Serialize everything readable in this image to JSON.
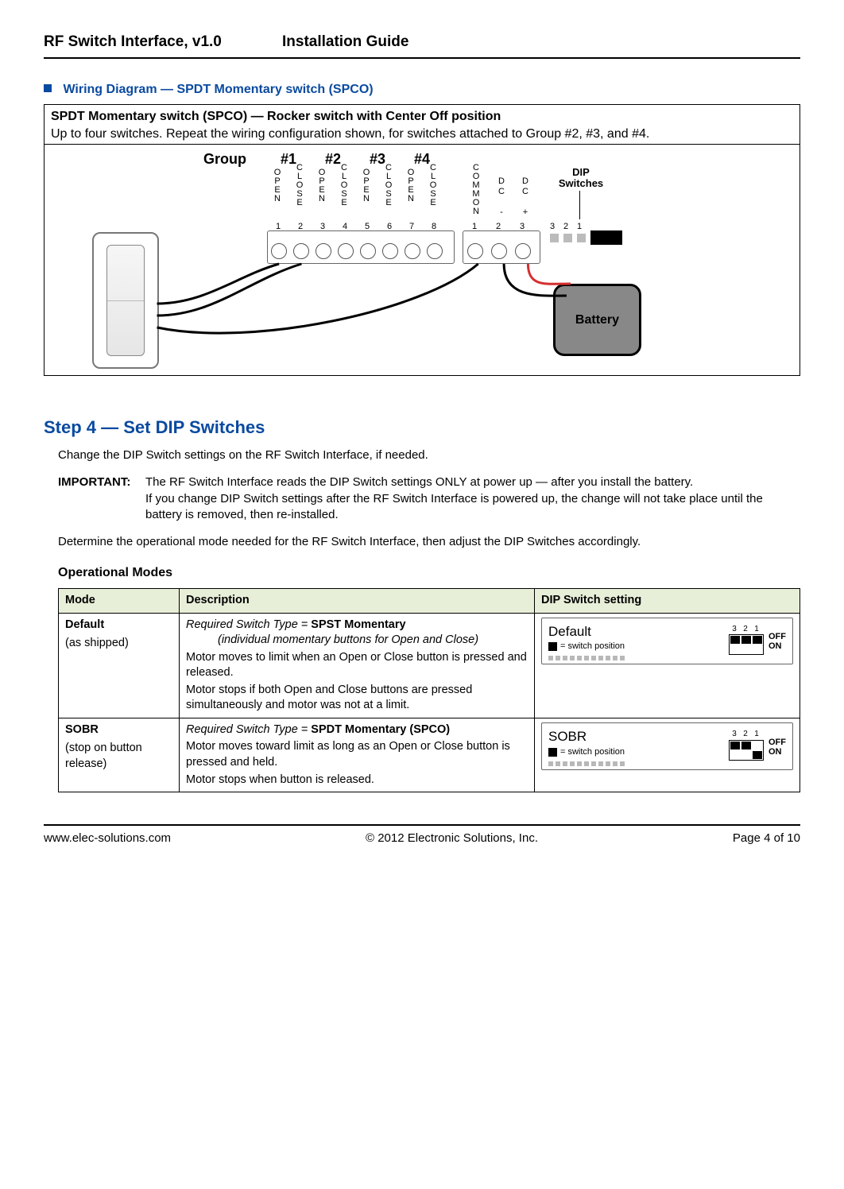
{
  "header": {
    "product": "RF Switch Interface, v1.0",
    "doc_type": "Installation Guide"
  },
  "wiring": {
    "heading": "Wiring Diagram — SPDT Momentary switch (SPCO)",
    "panel_title": "SPDT Momentary switch (SPCO) — Rocker switch with Center Off position",
    "panel_sub": "Up to four switches. Repeat the wiring configuration shown, for switches attached to Group #2, #3, and #4.",
    "group_label": "Group",
    "groups": [
      "#1",
      "#2",
      "#3",
      "#4"
    ],
    "pin_labels": [
      "OPEN",
      "CLOSE",
      "OPEN",
      "CLOSE",
      "OPEN",
      "CLOSE",
      "OPEN",
      "CLOSE"
    ],
    "bus_labels": [
      "COMMON",
      "DC -",
      "DC +"
    ],
    "dip_label": "DIP\nSwitches",
    "battery_label": "Battery",
    "term8_nums": [
      "1",
      "2",
      "3",
      "4",
      "5",
      "6",
      "7",
      "8"
    ],
    "term3_nums": [
      "1",
      "2",
      "3"
    ],
    "dip_main_nums": [
      "3",
      "2",
      "1"
    ]
  },
  "step4": {
    "title": "Step 4 — Set DIP Switches",
    "intro": "Change the DIP Switch settings on the RF Switch Interface, if needed.",
    "important_label": "IMPORTANT:",
    "important_body": "The RF Switch Interface reads the DIP Switch settings ONLY at power up — after you install the battery.\nIf you change DIP Switch settings after the RF Switch Interface is powered up, the change will not take place until the battery is removed, then re-installed.",
    "determine": "Determine the operational mode needed for the RF Switch Interface, then adjust the DIP Switches accordingly.",
    "modes_heading": "Operational Modes",
    "table": {
      "headers": [
        "Mode",
        "Description",
        "DIP Switch setting"
      ],
      "rows": [
        {
          "mode_title": "Default",
          "mode_sub": "(as shipped)",
          "req_prefix": "Required Switch Type = ",
          "req_type": "SPST Momentary",
          "req_sub": "(individual momentary buttons for Open and Close)",
          "body_a": "Motor moves to limit when an Open or Close button is pressed and released.",
          "body_b": "Motor stops if both Open and Close buttons are pressed simultaneously and motor was not at a limit.",
          "dip_name": "Default",
          "dip_legend": "= switch position",
          "dip_nums": [
            "3",
            "2",
            "1"
          ],
          "dip_pattern": [
            "off",
            "off",
            "off"
          ],
          "off_label": "OFF",
          "on_label": "ON"
        },
        {
          "mode_title": "SOBR",
          "mode_sub": "(stop on button release)",
          "req_prefix": "Required Switch Type = ",
          "req_type": "SPDT Momentary (SPCO)",
          "req_sub": "",
          "body_a": "Motor moves toward limit as long as an Open or Close button is pressed and held.",
          "body_b": "Motor stops when button is released.",
          "dip_name": "SOBR",
          "dip_legend": "= switch position",
          "dip_nums": [
            "3",
            "2",
            "1"
          ],
          "dip_pattern": [
            "off",
            "off",
            "on"
          ],
          "off_label": "OFF",
          "on_label": "ON"
        }
      ]
    }
  },
  "footer": {
    "url": "www.elec-solutions.com",
    "copyright": "© 2012 Electronic Solutions, Inc.",
    "page": "Page 4 of 10"
  }
}
